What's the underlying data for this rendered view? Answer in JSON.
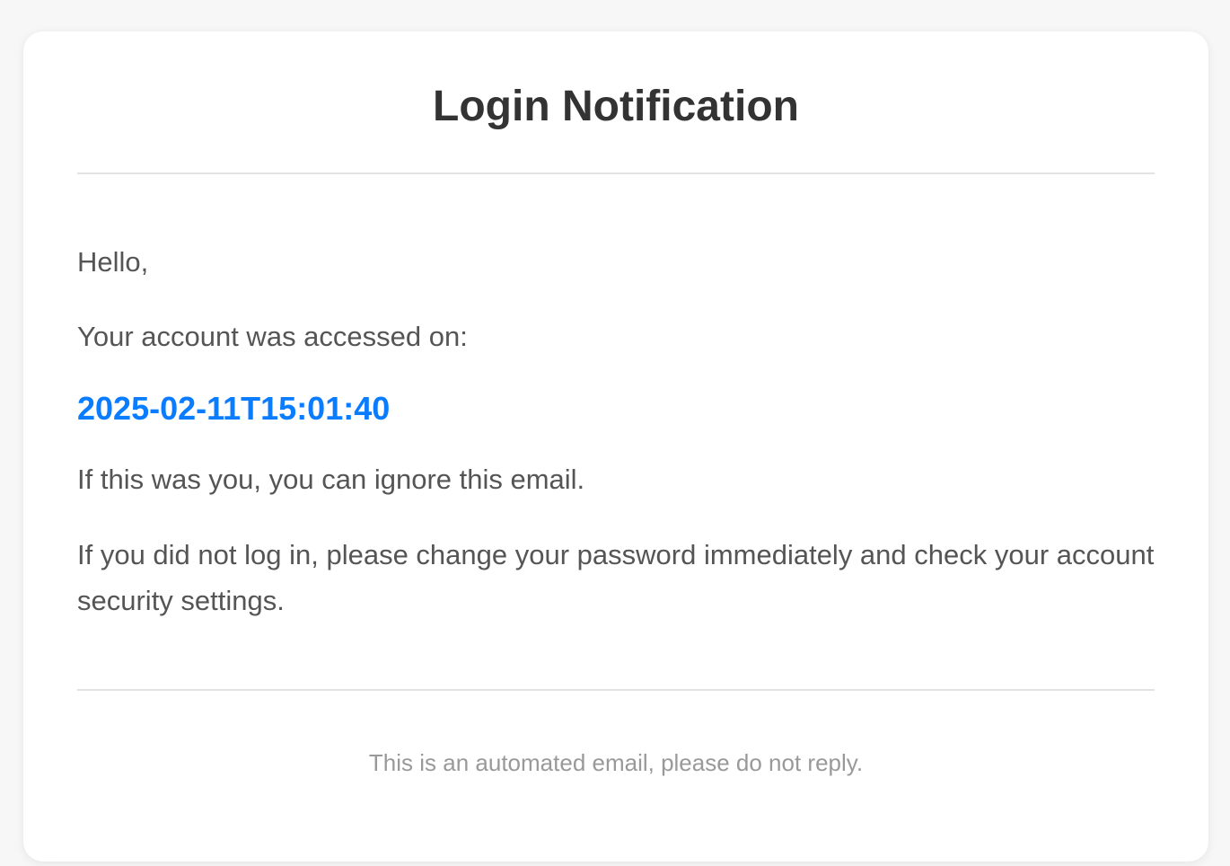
{
  "email": {
    "title": "Login Notification",
    "greeting": "Hello,",
    "access_intro": "Your account was accessed on:",
    "access_timestamp": "2025-02-11T15:01:40",
    "ignore_note": "If this was you, you can ignore this email.",
    "security_warning": "If you did not log in, please change your password immediately and check your account security settings.",
    "footer_note": "This is an automated email, please do not reply."
  },
  "colors": {
    "background": "#f7f7f7",
    "card": "#ffffff",
    "title": "#333333",
    "body_text": "#555555",
    "timestamp": "#0a7cff",
    "footer_text": "#999999",
    "divider": "#e3e3e3"
  }
}
